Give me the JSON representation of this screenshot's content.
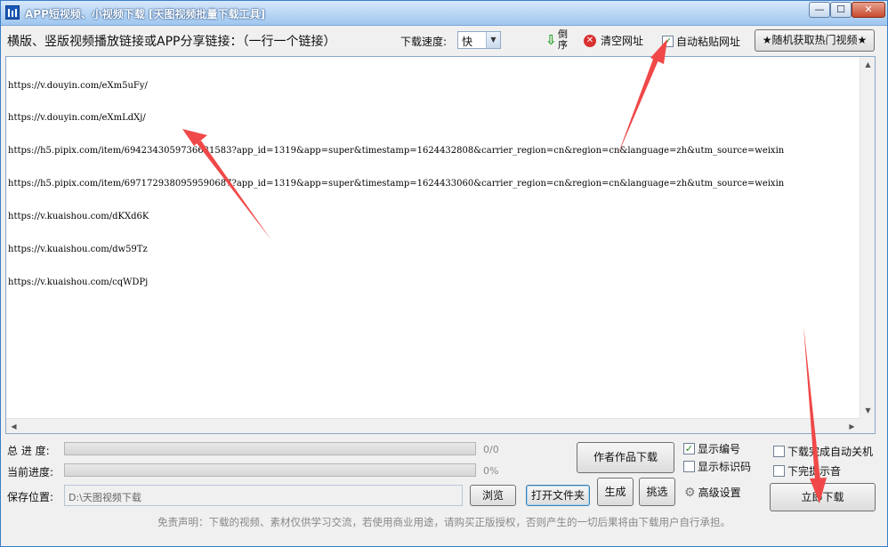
{
  "window": {
    "title": "APP短视频、小视频下载 [天图视频批量下载工具]",
    "min_symbol": "—",
    "max_symbol": "☐",
    "close_symbol": "✕"
  },
  "toolbar": {
    "link_label": "横版、竖版视频播放链接或APP分享链接：（一行一个链接）",
    "speed_label": "下载速度:",
    "speed_value": "快",
    "reverse_label": "倒序",
    "clear_label": "清空网址",
    "auto_paste_label": "自动粘贴网址",
    "auto_paste_checked": true,
    "hot_label": "★随机获取热门视频★"
  },
  "urls": [
    "https://v.douyin.com/eXm5uFy/",
    "https://v.douyin.com/eXmLdXj/",
    "https://h5.pipix.com/item/6942343059736631583?app_id=1319&app=super&timestamp=1624432808&carrier_region=cn&region=cn&language=zh&utm_source=weixin",
    "https://h5.pipix.com/item/6971729380959590687?app_id=1319&app=super&timestamp=1624433060&carrier_region=cn&region=cn&language=zh&utm_source=weixin",
    "https://v.kuaishou.com/dKXd6K",
    "https://v.kuaishou.com/dw59Tz",
    "https://v.kuaishou.com/cqWDPj"
  ],
  "progress": {
    "total_label": "总 进 度:",
    "total_value": "0/0",
    "total_fraction": 0,
    "current_label": "当前进度:",
    "current_value": "0%",
    "current_fraction": 0
  },
  "save": {
    "label": "保存位置:",
    "path": "D:\\天图视频下载",
    "browse_label": "浏览",
    "open_folder_label": "打开文件夹"
  },
  "actions": {
    "author_works_label": "作者作品下载",
    "generate_label": "生成",
    "pick_label": "挑选",
    "show_number_label": "显示编号",
    "show_number_checked": true,
    "show_id_label": "显示标识码",
    "show_id_checked": false,
    "advanced_label": "高级设置",
    "shutdown_label": "下载完成自动关机",
    "shutdown_checked": false,
    "sound_label": "下完提示音",
    "sound_checked": false,
    "download_label": "立即下载"
  },
  "disclaimer": "免责声明：下载的视频、素材仅供学习交流，若使用商业用途，请购买正版授权，否则产生的一切后果将由下载用户自行承担。",
  "colors": {
    "title_gradient_top": "#d6e8fb",
    "title_gradient_bottom": "#9fc6ef",
    "arrow_red": "#f04848",
    "progress_green": "#37b24d"
  }
}
